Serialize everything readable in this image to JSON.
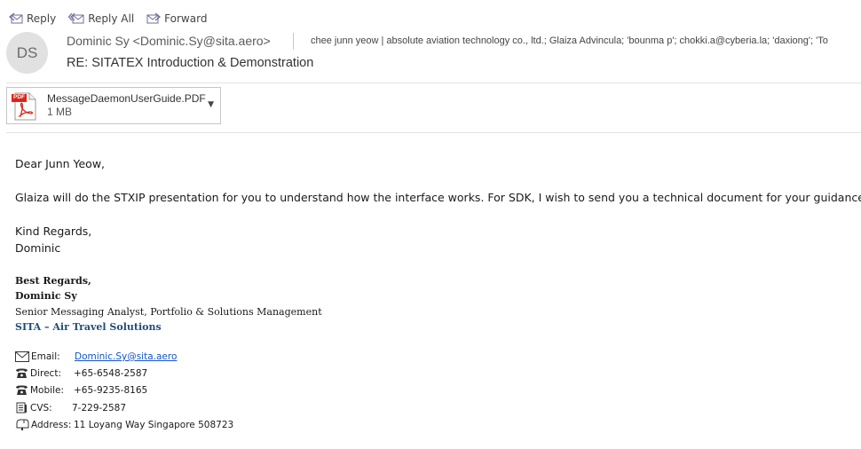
{
  "toolbar": {
    "reply": "Reply",
    "reply_all": "Reply All",
    "forward": "Forward"
  },
  "header": {
    "avatar_initials": "DS",
    "sender": "Dominic Sy <Dominic.Sy@sita.aero>",
    "recipients": "chee junn yeow | absolute aviation technology co., ltd.; Glaiza Advincula; 'bounma p'; chokki.a@cyberia.la; 'daxiong'; 'To",
    "subject": "RE: SITATEX Introduction & Demonstration"
  },
  "attachment": {
    "filename": "MessageDaemonUserGuide.PDF",
    "size": "1 MB",
    "badge": "PDF"
  },
  "body": {
    "greeting": "Dear Junn Yeow,",
    "paragraph": "Glaiza will do the STXIP presentation for you to understand how the interface works. For SDK, I wish to send you a technical document for your guidance.",
    "closing": "Kind Regards,",
    "name": "Dominic"
  },
  "signature": {
    "best_regards": "Best Regards,",
    "name": "Dominic Sy",
    "title": "Senior Messaging Analyst, Portfolio & Solutions Management",
    "company": "SITA – Air Travel Solutions",
    "email_label": "Email:",
    "email_value": "Dominic.Sy@sita.aero",
    "direct_label": "Direct:",
    "direct_value": "+65-6548-2587",
    "mobile_label": "Mobile:",
    "mobile_value": "+65-9235-8165",
    "cvs_label": "CVS:",
    "cvs_value": "7-229-2587",
    "address_label": "Address:",
    "address_value": "11 Loyang Way Singapore 508723"
  },
  "colors": {
    "link": "#1155cc",
    "company": "#1f4e79",
    "pdf_red": "#d9261c"
  }
}
